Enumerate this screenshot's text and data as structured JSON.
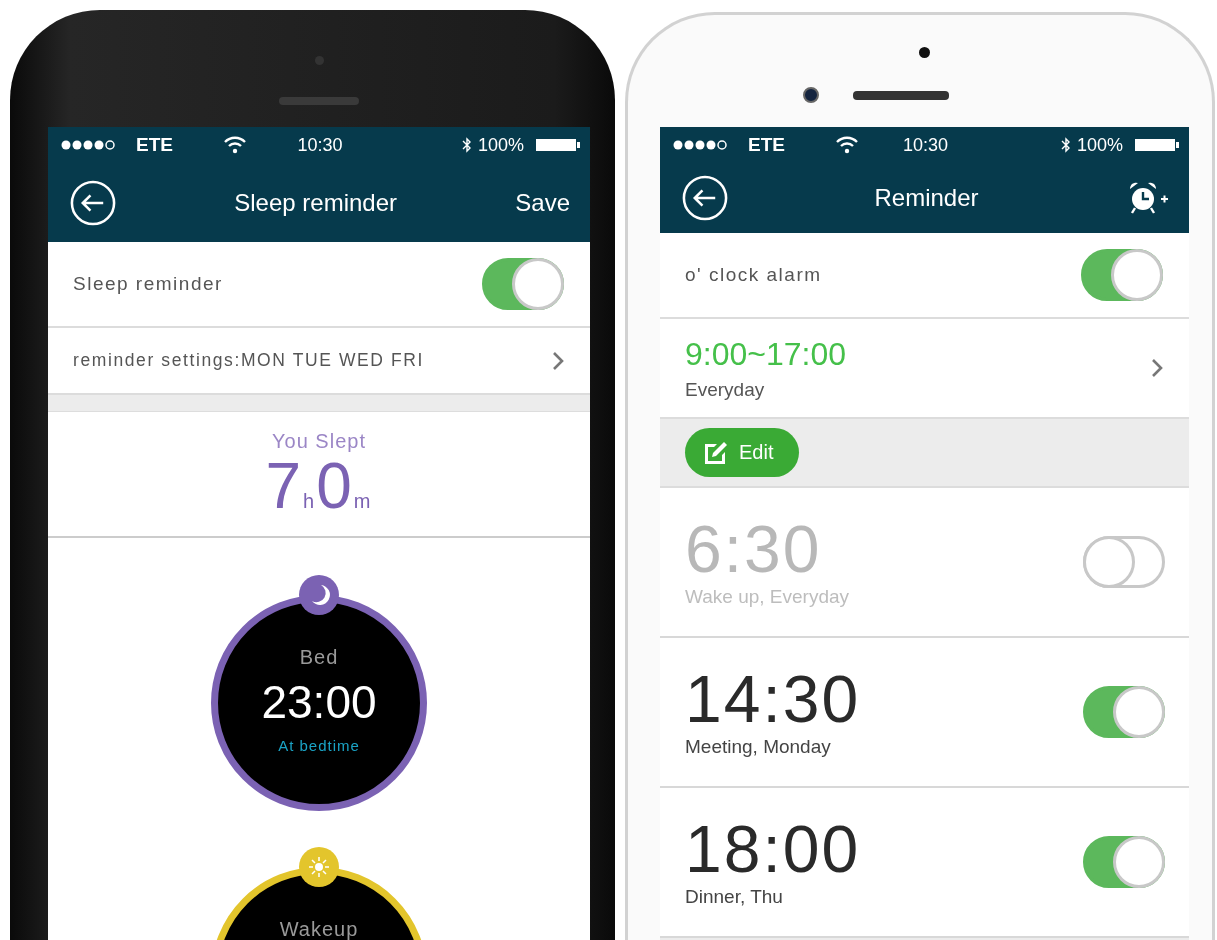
{
  "left_screen": {
    "status_bar": {
      "carrier": "ETE",
      "time": "10:30",
      "battery": "100%"
    },
    "nav": {
      "title": "Sleep reminder",
      "action": "Save"
    },
    "reminder_toggle": {
      "label": "Sleep reminder",
      "on": true
    },
    "settings_row": {
      "label": "reminder settings:MON TUE WED FRI"
    },
    "sleep_summary": {
      "title": "You Slept",
      "hours": "7",
      "hours_unit": "h",
      "minutes": "0",
      "minutes_unit": "m"
    },
    "dials": [
      {
        "kind": "bed",
        "label": "Bed",
        "time": "23:00",
        "note": "At bedtime",
        "color": "#7b62b3"
      },
      {
        "kind": "wakeup",
        "label": "Wakeup",
        "color": "#e3c52c"
      }
    ]
  },
  "right_screen": {
    "status_bar": {
      "carrier": "ETE",
      "time": "10:30",
      "battery": "100%"
    },
    "nav": {
      "title": "Reminder"
    },
    "hourly_alarm": {
      "label": "o' clock alarm",
      "on": true
    },
    "range_row": {
      "time": "9:00~17:00",
      "repeat": "Everyday"
    },
    "edit_button": {
      "label": "Edit"
    },
    "alarms": [
      {
        "time": "6:30",
        "note": "Wake up, Everyday",
        "on": false
      },
      {
        "time": "14:30",
        "note": "Meeting, Monday",
        "on": true
      },
      {
        "time": "18:00",
        "note": "Dinner, Thu",
        "on": true
      }
    ]
  }
}
